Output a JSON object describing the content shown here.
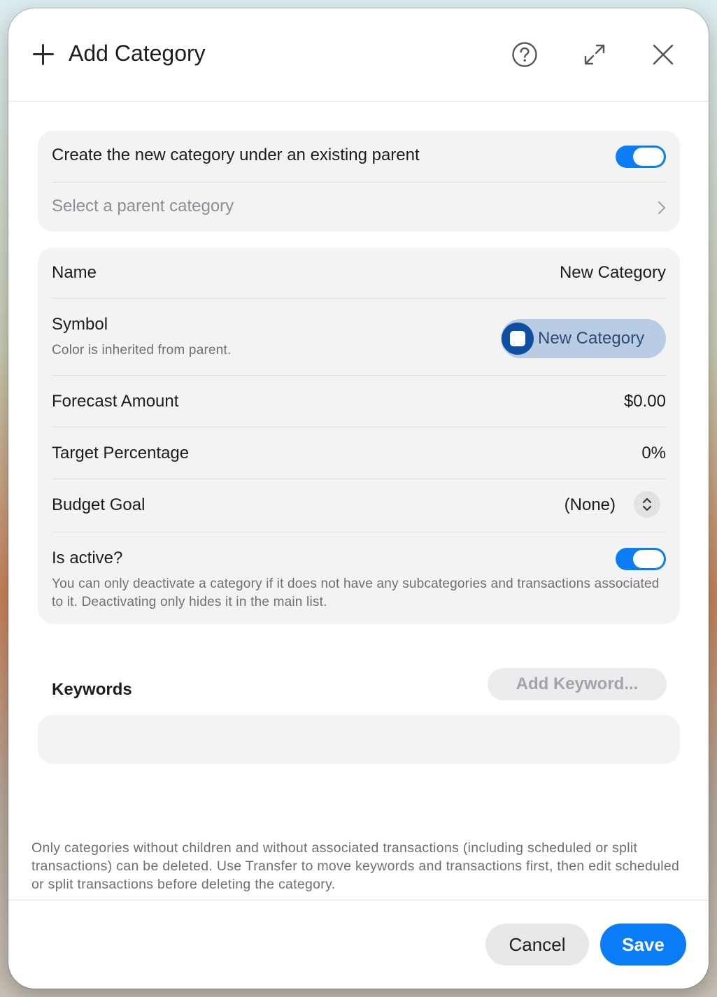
{
  "header": {
    "title": "Add Category"
  },
  "parent_section": {
    "toggle_label": "Create the new category under an existing parent",
    "toggle_on": true,
    "parent_placeholder": "Select a parent category"
  },
  "fields": {
    "name_label": "Name",
    "name_value": "New Category",
    "symbol_label": "Symbol",
    "symbol_hint": "Color is inherited from parent.",
    "symbol_value": "New Category",
    "forecast_label": "Forecast Amount",
    "forecast_value": "$0.00",
    "target_label": "Target Percentage",
    "target_value": "0%",
    "budget_label": "Budget Goal",
    "budget_value": "(None)",
    "active_label": "Is active?",
    "active_on": true,
    "active_hint": "You can only deactivate a category if it does not have any subcategories and transactions associated to it. Deactivating only hides it in the main list."
  },
  "keywords": {
    "title": "Keywords",
    "add_label": "Add Keyword..."
  },
  "footer": {
    "note": "Only categories without children and without associated transactions (including scheduled or split transactions) can be deleted. Use Transfer to move keywords and transactions first, then edit scheduled or split transactions before deleting the category.",
    "cancel_label": "Cancel",
    "save_label": "Save"
  },
  "colors": {
    "accent": "#0a7cf5",
    "symbol_circle": "#0f4fa3",
    "symbol_pill": "#b8cde3"
  },
  "icons": {
    "add": "plus-icon",
    "help": "question-circle-icon",
    "expand": "expand-arrows-icon",
    "close": "close-icon",
    "chevron": "chevron-right-icon",
    "stepper": "chevron-up-down-icon"
  }
}
